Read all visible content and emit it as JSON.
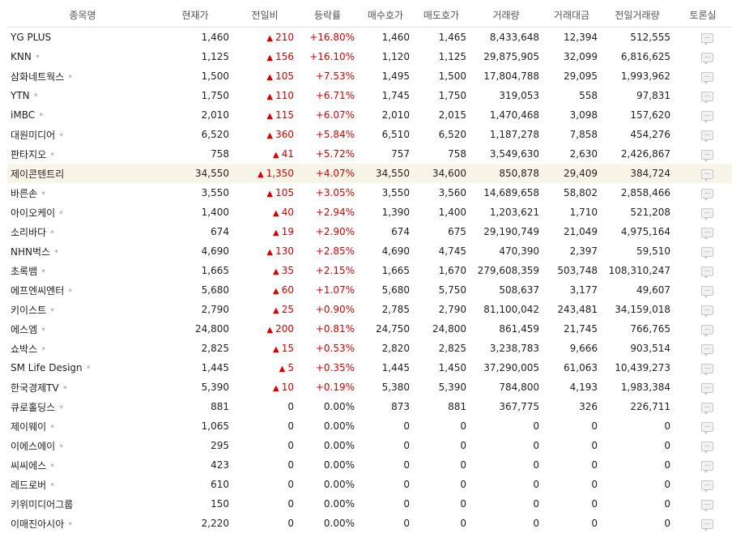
{
  "headers": [
    "종목명",
    "현재가",
    "전일비",
    "등락률",
    "매수호가",
    "매도호가",
    "거래량",
    "거래대금",
    "전일거래량",
    "토론실"
  ],
  "colors": {
    "up": "#d60000",
    "highlight_row": "#f7f5e7",
    "header_text": "#555555"
  },
  "icons": {
    "rise": "triangle-up-icon",
    "board": "speech-bubble-icon"
  },
  "rows": [
    {
      "name": "YG PLUS",
      "star": "",
      "price": "1,460",
      "change": "210",
      "dir": "up",
      "rate": "+16.80%",
      "bid": "1,460",
      "ask": "1,465",
      "volume": "8,433,648",
      "amount": "12,394",
      "prev_volume": "512,555"
    },
    {
      "name": "KNN",
      "star": "*",
      "price": "1,125",
      "change": "156",
      "dir": "up",
      "rate": "+16.10%",
      "bid": "1,120",
      "ask": "1,125",
      "volume": "29,875,905",
      "amount": "32,099",
      "prev_volume": "6,816,625"
    },
    {
      "name": "삼화네트웍스",
      "star": "*",
      "price": "1,500",
      "change": "105",
      "dir": "up",
      "rate": "+7.53%",
      "bid": "1,495",
      "ask": "1,500",
      "volume": "17,804,788",
      "amount": "29,095",
      "prev_volume": "1,993,962"
    },
    {
      "name": "YTN",
      "star": "*",
      "price": "1,750",
      "change": "110",
      "dir": "up",
      "rate": "+6.71%",
      "bid": "1,745",
      "ask": "1,750",
      "volume": "319,053",
      "amount": "558",
      "prev_volume": "97,831"
    },
    {
      "name": "iMBC",
      "star": "*",
      "price": "2,010",
      "change": "115",
      "dir": "up",
      "rate": "+6.07%",
      "bid": "2,010",
      "ask": "2,015",
      "volume": "1,470,468",
      "amount": "3,098",
      "prev_volume": "157,620"
    },
    {
      "name": "대원미디어",
      "star": "*",
      "price": "6,520",
      "change": "360",
      "dir": "up",
      "rate": "+5.84%",
      "bid": "6,510",
      "ask": "6,520",
      "volume": "1,187,278",
      "amount": "7,858",
      "prev_volume": "454,276"
    },
    {
      "name": "판타지오",
      "star": "*",
      "price": "758",
      "change": "41",
      "dir": "up",
      "rate": "+5.72%",
      "bid": "757",
      "ask": "758",
      "volume": "3,549,630",
      "amount": "2,630",
      "prev_volume": "2,426,867"
    },
    {
      "name": "제이콘텐트리",
      "star": "",
      "price": "34,550",
      "change": "1,350",
      "dir": "up",
      "rate": "+4.07%",
      "bid": "34,550",
      "ask": "34,600",
      "volume": "850,878",
      "amount": "29,409",
      "prev_volume": "384,724",
      "highlight": true
    },
    {
      "name": "바른손",
      "star": "*",
      "price": "3,550",
      "change": "105",
      "dir": "up",
      "rate": "+3.05%",
      "bid": "3,550",
      "ask": "3,560",
      "volume": "14,689,658",
      "amount": "58,802",
      "prev_volume": "2,858,466"
    },
    {
      "name": "아이오케이",
      "star": "*",
      "price": "1,400",
      "change": "40",
      "dir": "up",
      "rate": "+2.94%",
      "bid": "1,390",
      "ask": "1,400",
      "volume": "1,203,621",
      "amount": "1,710",
      "prev_volume": "521,208"
    },
    {
      "name": "소리바다",
      "star": "*",
      "price": "674",
      "change": "19",
      "dir": "up",
      "rate": "+2.90%",
      "bid": "674",
      "ask": "675",
      "volume": "29,190,749",
      "amount": "21,049",
      "prev_volume": "4,975,164"
    },
    {
      "name": "NHN벅스",
      "star": "*",
      "price": "4,690",
      "change": "130",
      "dir": "up",
      "rate": "+2.85%",
      "bid": "4,690",
      "ask": "4,745",
      "volume": "470,390",
      "amount": "2,397",
      "prev_volume": "59,510"
    },
    {
      "name": "초록뱀",
      "star": "*",
      "price": "1,665",
      "change": "35",
      "dir": "up",
      "rate": "+2.15%",
      "bid": "1,665",
      "ask": "1,670",
      "volume": "279,608,359",
      "amount": "503,748",
      "prev_volume": "108,310,247"
    },
    {
      "name": "에프엔씨엔터",
      "star": "*",
      "price": "5,680",
      "change": "60",
      "dir": "up",
      "rate": "+1.07%",
      "bid": "5,680",
      "ask": "5,750",
      "volume": "508,637",
      "amount": "3,177",
      "prev_volume": "49,607"
    },
    {
      "name": "키이스트",
      "star": "*",
      "price": "2,790",
      "change": "25",
      "dir": "up",
      "rate": "+0.90%",
      "bid": "2,785",
      "ask": "2,790",
      "volume": "81,100,042",
      "amount": "243,481",
      "prev_volume": "34,159,018"
    },
    {
      "name": "에스엠",
      "star": "*",
      "price": "24,800",
      "change": "200",
      "dir": "up",
      "rate": "+0.81%",
      "bid": "24,750",
      "ask": "24,800",
      "volume": "861,459",
      "amount": "21,745",
      "prev_volume": "766,765"
    },
    {
      "name": "쇼박스",
      "star": "*",
      "price": "2,825",
      "change": "15",
      "dir": "up",
      "rate": "+0.53%",
      "bid": "2,820",
      "ask": "2,825",
      "volume": "3,238,783",
      "amount": "9,666",
      "prev_volume": "903,514"
    },
    {
      "name": "SM Life Design",
      "star": "*",
      "price": "1,445",
      "change": "5",
      "dir": "up",
      "rate": "+0.35%",
      "bid": "1,445",
      "ask": "1,450",
      "volume": "37,290,005",
      "amount": "61,063",
      "prev_volume": "10,439,273"
    },
    {
      "name": "한국경제TV",
      "star": "*",
      "price": "5,390",
      "change": "10",
      "dir": "up",
      "rate": "+0.19%",
      "bid": "5,380",
      "ask": "5,390",
      "volume": "784,800",
      "amount": "4,193",
      "prev_volume": "1,983,384"
    },
    {
      "name": "큐로홀딩스",
      "star": "*",
      "price": "881",
      "change": "0",
      "dir": "flat",
      "rate": "0.00%",
      "bid": "873",
      "ask": "881",
      "volume": "367,775",
      "amount": "326",
      "prev_volume": "226,711"
    },
    {
      "name": "제이웨이",
      "star": "*",
      "price": "1,065",
      "change": "0",
      "dir": "flat",
      "rate": "0.00%",
      "bid": "0",
      "ask": "0",
      "volume": "0",
      "amount": "0",
      "prev_volume": "0"
    },
    {
      "name": "이에스에이",
      "star": "*",
      "price": "295",
      "change": "0",
      "dir": "flat",
      "rate": "0.00%",
      "bid": "0",
      "ask": "0",
      "volume": "0",
      "amount": "0",
      "prev_volume": "0"
    },
    {
      "name": "씨씨에스",
      "star": "*",
      "price": "423",
      "change": "0",
      "dir": "flat",
      "rate": "0.00%",
      "bid": "0",
      "ask": "0",
      "volume": "0",
      "amount": "0",
      "prev_volume": "0"
    },
    {
      "name": "레드로버",
      "star": "*",
      "price": "610",
      "change": "0",
      "dir": "flat",
      "rate": "0.00%",
      "bid": "0",
      "ask": "0",
      "volume": "0",
      "amount": "0",
      "prev_volume": "0"
    },
    {
      "name": "키위미디어그룹",
      "star": "",
      "price": "150",
      "change": "0",
      "dir": "flat",
      "rate": "0.00%",
      "bid": "0",
      "ask": "0",
      "volume": "0",
      "amount": "0",
      "prev_volume": "0"
    },
    {
      "name": "이매진아시아",
      "star": "*",
      "price": "2,220",
      "change": "0",
      "dir": "flat",
      "rate": "0.00%",
      "bid": "0",
      "ask": "0",
      "volume": "0",
      "amount": "0",
      "prev_volume": "0"
    }
  ]
}
